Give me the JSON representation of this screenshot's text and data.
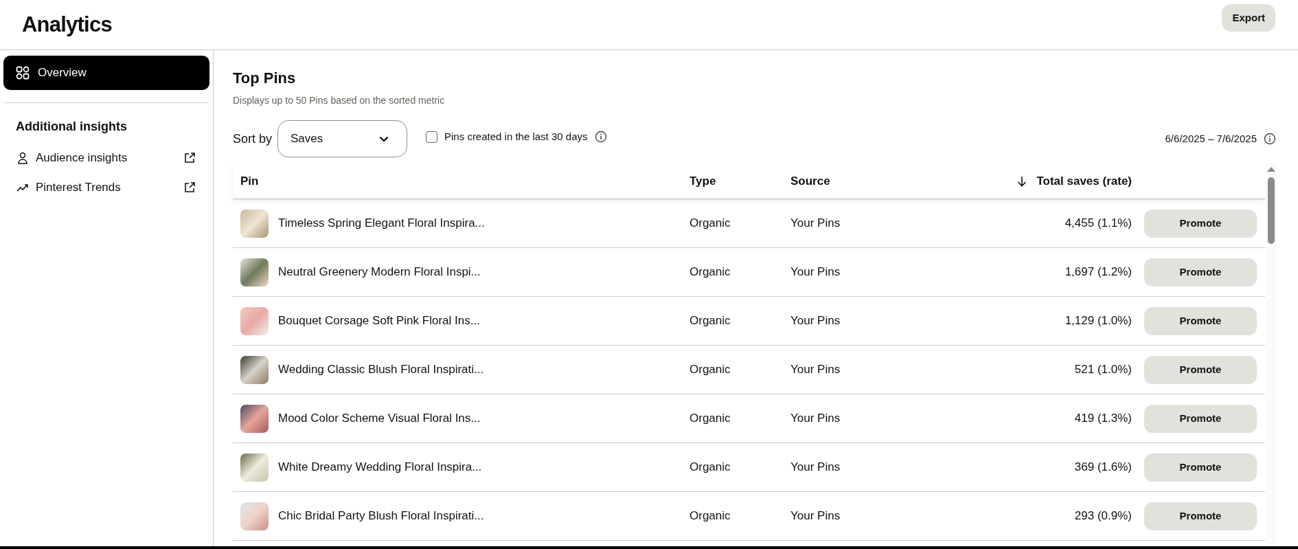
{
  "header": {
    "title": "Analytics",
    "export_button": "Export"
  },
  "sidebar": {
    "items": [
      {
        "label": "Overview",
        "selected": true
      }
    ],
    "section_title": "Additional insights",
    "links": [
      {
        "label": "Audience insights"
      },
      {
        "label": "Pinterest Trends"
      }
    ]
  },
  "main": {
    "title": "Top Pins",
    "subtitle": "Displays up to 50 Pins based on the sorted metric",
    "sort_label": "Sort by",
    "sort_value": "Saves",
    "filter": {
      "label": "Pins created in the last 30 days",
      "checked": false
    },
    "date_range": "6/6/2025 – 7/6/2025"
  },
  "table": {
    "columns": [
      {
        "label": "Pin",
        "sorted": false
      },
      {
        "label": "Type",
        "sorted": false
      },
      {
        "label": "Source",
        "sorted": false
      },
      {
        "label": "Total saves (rate)",
        "sorted": true
      }
    ],
    "rows": [
      {
        "pin": "Timeless Spring Elegant Floral Inspira...",
        "type": "Organic",
        "source": "Your Pins",
        "saves": "4,455 (1.1%)",
        "action": "Promote"
      },
      {
        "pin": "Neutral Greenery Modern Floral Inspi...",
        "type": "Organic",
        "source": "Your Pins",
        "saves": "1,697 (1.2%)",
        "action": "Promote"
      },
      {
        "pin": "Bouquet Corsage Soft Pink Floral Ins...",
        "type": "Organic",
        "source": "Your Pins",
        "saves": "1,129 (1.0%)",
        "action": "Promote"
      },
      {
        "pin": "Wedding Classic Blush Floral Inspirati...",
        "type": "Organic",
        "source": "Your Pins",
        "saves": "521 (1.0%)",
        "action": "Promote"
      },
      {
        "pin": "Mood Color Scheme Visual Floral Ins...",
        "type": "Organic",
        "source": "Your Pins",
        "saves": "419 (1.3%)",
        "action": "Promote"
      },
      {
        "pin": "White Dreamy Wedding Floral Inspira...",
        "type": "Organic",
        "source": "Your Pins",
        "saves": "369 (1.6%)",
        "action": "Promote"
      },
      {
        "pin": "Chic Bridal Party Blush Floral Inspirati...",
        "type": "Organic",
        "source": "Your Pins",
        "saves": "293 (0.9%)",
        "action": "Promote"
      }
    ]
  }
}
